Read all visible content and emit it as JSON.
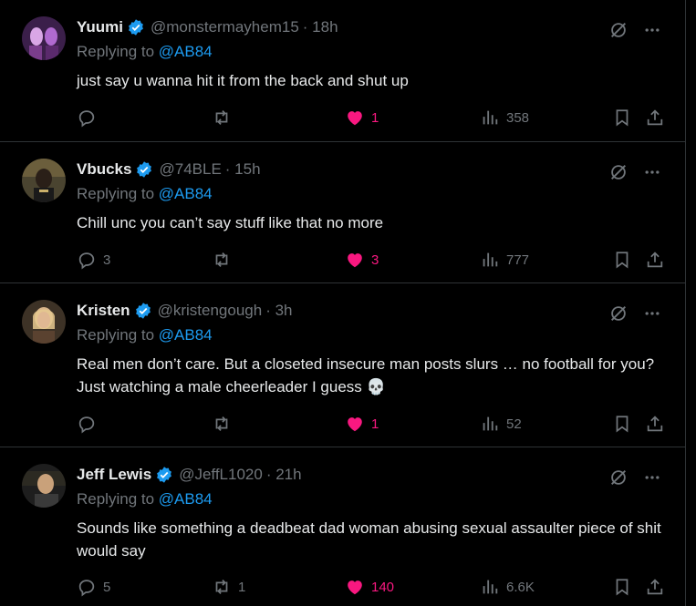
{
  "tweets": [
    {
      "name": "Yuumi",
      "handle": "@monstermayhem15",
      "time": "· 18h",
      "replying_prefix": "Replying to ",
      "replying_to": "@AB84",
      "text": "just say u wanna hit it from the back and shut up",
      "replies": "",
      "retweets": "",
      "likes": "1",
      "views": "358",
      "avatar_colors": [
        "#7a3d8c",
        "#d9a6e6"
      ]
    },
    {
      "name": "Vbucks",
      "handle": "@74BLE",
      "time": "· 15h",
      "replying_prefix": "Replying to ",
      "replying_to": "@AB84",
      "text": "Chill unc you can’t say stuff like that no more",
      "replies": "3",
      "retweets": "",
      "likes": "3",
      "views": "777",
      "avatar_colors": [
        "#3e3a2a",
        "#8b7b55"
      ]
    },
    {
      "name": "Kristen",
      "handle": "@kristengough",
      "time": "· 3h",
      "replying_prefix": "Replying to ",
      "replying_to": "@AB84",
      "text": "Real men don’t care. But a closeted insecure man posts slurs … no football for you? Just watching a male cheerleader I guess 💀",
      "replies": "",
      "retweets": "",
      "likes": "1",
      "views": "52",
      "avatar_colors": [
        "#5a4230",
        "#d8b48a"
      ]
    },
    {
      "name": "Jeff Lewis",
      "handle": "@JeffL1020",
      "time": "· 21h",
      "replying_prefix": "Replying to ",
      "replying_to": "@AB84",
      "text": "Sounds like something a deadbeat dad woman abusing sexual assaulter piece of shit would say",
      "replies": "5",
      "retweets": "1",
      "likes": "140",
      "views": "6.6K",
      "avatar_colors": [
        "#2a2a2a",
        "#c9a17a"
      ]
    }
  ],
  "colors": {
    "background": "#000000",
    "text": "#e7e9ea",
    "muted": "#71767b",
    "link": "#1d9bf0",
    "like": "#f91880",
    "divider": "#2f3336"
  }
}
